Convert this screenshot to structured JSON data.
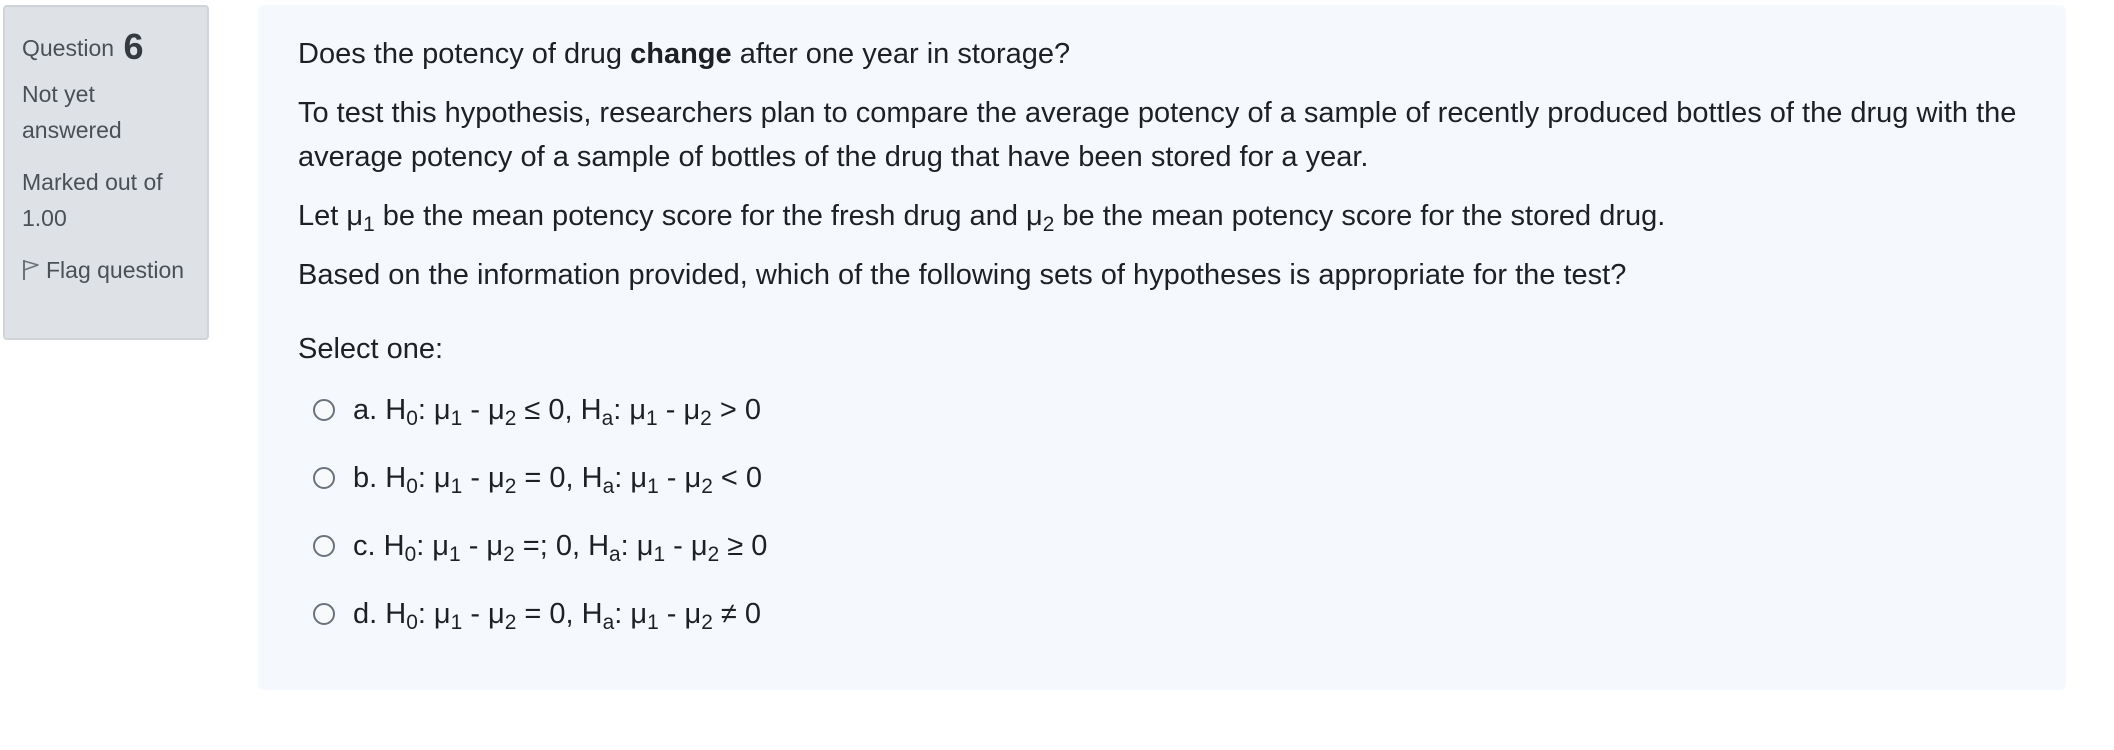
{
  "info": {
    "question_label": "Question",
    "question_number": "6",
    "state": "Not yet answered",
    "grade": "Marked out of 1.00",
    "flag_label": "Flag question",
    "flag_icon": "flag-icon"
  },
  "question": {
    "line1_pre": "Does the potency of drug ",
    "line1_bold": "change",
    "line1_post": " after one year in storage?",
    "para2": "To test this hypothesis, researchers plan to compare the average potency of a sample of recently produced bottles of the drug with the average potency of a sample of bottles of the drug that have been stored for a year.",
    "para3_a": "Let μ",
    "sub_1": "1",
    "para3_b": " be the mean potency score for the fresh drug and μ",
    "sub_2": "2",
    "para3_c": " be the mean potency score for the stored drug.",
    "para4": "Based on the information provided, which of the following sets of hypotheses is appropriate for the test?",
    "select_prompt": "Select one:"
  },
  "options": [
    {
      "t1": "a. H",
      "s1": "0",
      "t2": ": μ",
      "s2": "1",
      "t3": " - μ",
      "s3": "2",
      "t4": " ≤ 0, H",
      "s4": "a",
      "t5": ": μ",
      "s5": "1",
      "t6": " - μ",
      "s6": "2",
      "t7": " > 0"
    },
    {
      "t1": "b. H",
      "s1": "0",
      "t2": ": μ",
      "s2": "1",
      "t3": " - μ",
      "s3": "2",
      "t4": " = 0, H",
      "s4": "a",
      "t5": ": μ",
      "s5": "1",
      "t6": " - μ",
      "s6": "2",
      "t7": " < 0"
    },
    {
      "t1": "c. H",
      "s1": "0",
      "t2": ": μ",
      "s2": "1",
      "t3": " - μ",
      "s3": "2",
      "t4": " =; 0, H",
      "s4": "a",
      "t5": ": μ",
      "s5": "1",
      "t6": " - μ",
      "s6": "2",
      "t7": " ≥ 0"
    },
    {
      "t1": "d. H",
      "s1": "0",
      "t2": ": μ",
      "s2": "1",
      "t3": " - μ",
      "s3": "2",
      "t4": " = 0, H",
      "s4": "a",
      "t5": ": μ",
      "s5": "1",
      "t6": " - μ",
      "s6": "2",
      "t7": " ≠ 0"
    }
  ]
}
